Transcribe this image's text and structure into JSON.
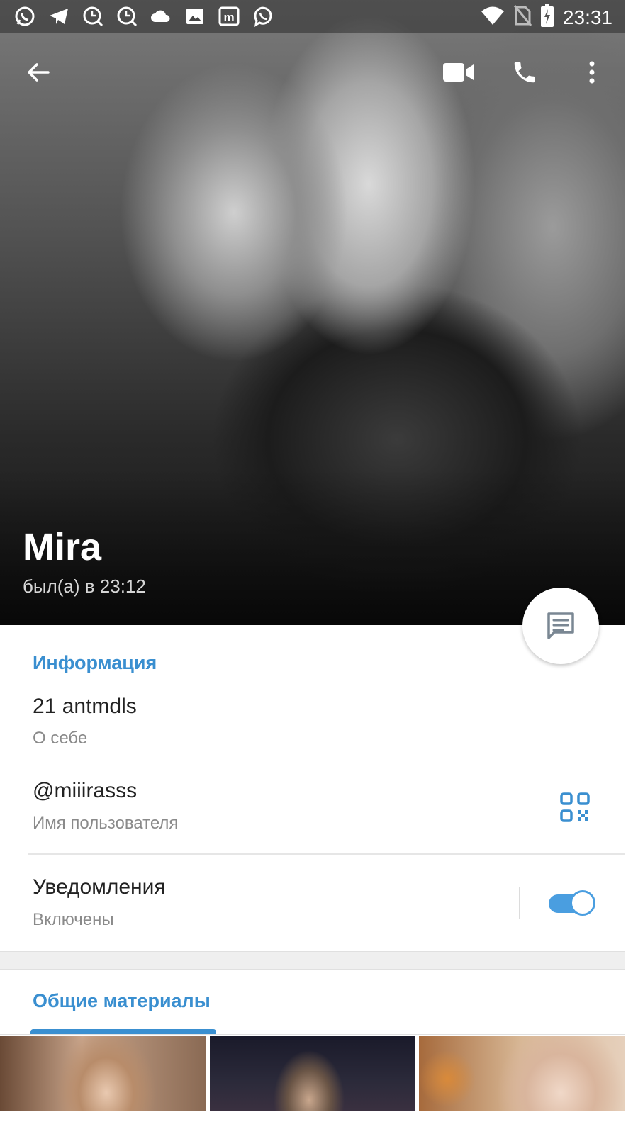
{
  "status_bar": {
    "time": "23:31",
    "left_icons": [
      "whatsapp-icon",
      "telegram-icon",
      "search-chat-icon",
      "search-chat-icon",
      "cloud-icon",
      "image-icon",
      "m-app-icon",
      "viber-icon"
    ],
    "right_icons": [
      "wifi-icon",
      "no-sim-icon",
      "battery-charging-icon"
    ]
  },
  "profile": {
    "name": "Mira",
    "last_seen": "был(а) в 23:12"
  },
  "info": {
    "section_title": "Информация",
    "bio_value": "21 antmdls",
    "bio_label": "О себе",
    "username_value": "@miiirasss",
    "username_label": "Имя пользователя",
    "notifications_title": "Уведомления",
    "notifications_state": "Включены",
    "notifications_on": true
  },
  "shared_media": {
    "tab_title": "Общие материалы",
    "thumbnails": [
      "photo-1",
      "photo-2",
      "photo-3"
    ]
  },
  "colors": {
    "accent": "#3a8fd0",
    "toggle": "#4a9ee0"
  }
}
